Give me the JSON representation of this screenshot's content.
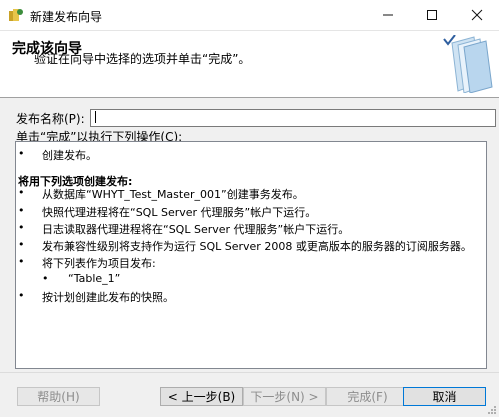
{
  "window": {
    "title": "新建发布向导",
    "controls": [
      "minimize",
      "maximize",
      "close"
    ]
  },
  "header": {
    "title": "完成该向导",
    "subtitle": "验证在向导中选择的选项并单击“完成”。"
  },
  "form": {
    "name_label": "发布名称(P):",
    "name_value": "",
    "actions_label": "单击“完成”以执行下列操作(C):"
  },
  "actions": [
    {
      "bullet": "•",
      "text": "创建发布。",
      "level": 0,
      "bold": false
    },
    {
      "bullet": "",
      "text": "",
      "level": 0,
      "bold": false
    },
    {
      "bullet": "",
      "text": "将用下列选项创建发布:",
      "level": 0,
      "bold": true
    },
    {
      "bullet": "•",
      "text": "从数据库“WHYT_Test_Master_001”创建事务发布。",
      "level": 0,
      "bold": false
    },
    {
      "bullet": "•",
      "text": "快照代理进程将在“SQL Server 代理服务”帐户下运行。",
      "level": 0,
      "bold": false
    },
    {
      "bullet": "•",
      "text": "日志读取器代理进程将在“SQL Server 代理服务”帐户下运行。",
      "level": 0,
      "bold": false
    },
    {
      "bullet": "•",
      "text": "发布兼容性级别将支持作为运行 SQL Server 2008 或更高版本的服务器的订阅服务器。",
      "level": 0,
      "bold": false
    },
    {
      "bullet": "•",
      "text": "将下列表作为项目发布:",
      "level": 0,
      "bold": false
    },
    {
      "bullet": "•",
      "text": "“Table_1”",
      "level": 1,
      "bold": false
    },
    {
      "bullet": "•",
      "text": "按计划创建此发布的快照。",
      "level": 0,
      "bold": false
    }
  ],
  "buttons": {
    "help": "帮助(H)",
    "back": "< 上一步(B)",
    "next": "下一步(N) >",
    "finish": "完成(F)",
    "cancel": "取消"
  }
}
